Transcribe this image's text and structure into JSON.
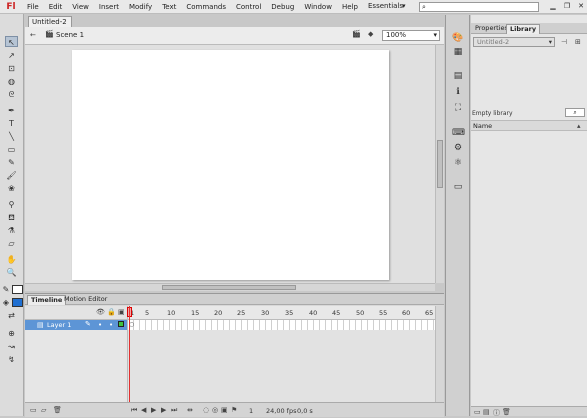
{
  "app": {
    "logo": "Fl",
    "menus": [
      "File",
      "Edit",
      "View",
      "Insert",
      "Modify",
      "Text",
      "Commands",
      "Control",
      "Debug",
      "Window",
      "Help"
    ],
    "workspace": "Essentials",
    "workspace_arrow": "▾",
    "search_icon": "search-icon",
    "search_glyph": "⌕"
  },
  "document": {
    "tab_title": "Untitled-2",
    "scene": "Scene 1",
    "zoom": "100%"
  },
  "timeline": {
    "tabs": [
      "Timeline",
      "Motion Editor"
    ],
    "frame_numbers": [
      "1",
      "5",
      "10",
      "15",
      "20",
      "25",
      "30",
      "35",
      "40",
      "45",
      "50",
      "55",
      "60",
      "65"
    ],
    "layer_name": "Layer 1",
    "footer": {
      "frame": "1",
      "fps": "24,00 fps",
      "time": "0,0 s"
    }
  },
  "right_panel": {
    "tabs": [
      "Properties",
      "Library"
    ],
    "document_select": "Untitled-2",
    "empty_label": "Empty library",
    "column_name": "Name"
  },
  "colors": {
    "stroke": "#000000",
    "fill": "#1f6fd1",
    "layer_highlight": "#5d95d6",
    "playhead": "#e23030"
  }
}
